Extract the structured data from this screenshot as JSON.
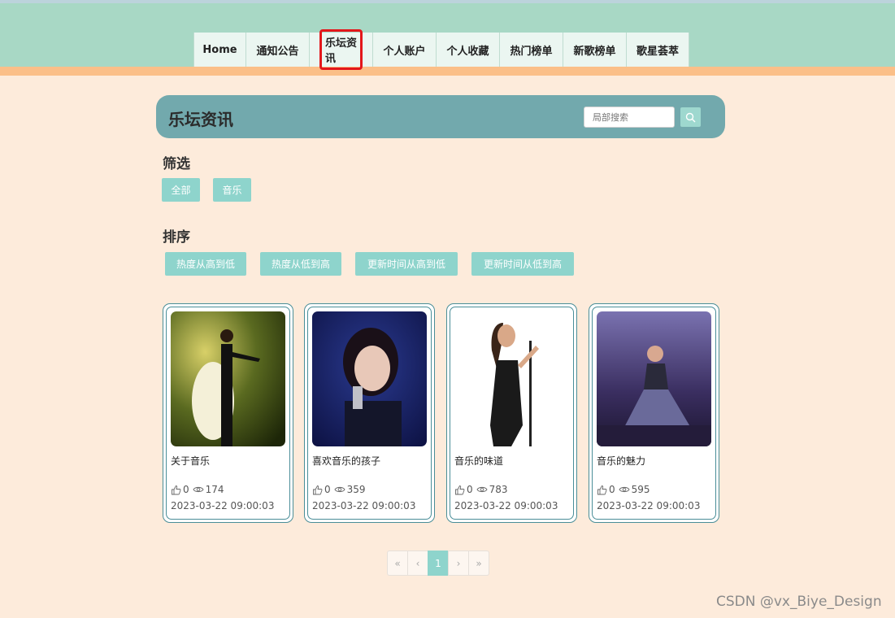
{
  "nav": {
    "items": [
      {
        "label": "Home"
      },
      {
        "label": "通知公告"
      },
      {
        "label": "乐坛资讯"
      },
      {
        "label": "个人账户"
      },
      {
        "label": "个人收藏"
      },
      {
        "label": "热门榜单"
      },
      {
        "label": "新歌榜单"
      },
      {
        "label": "歌星荟萃"
      }
    ],
    "active": "乐坛资讯"
  },
  "page": {
    "title": "乐坛资讯",
    "search_placeholder": "局部搜索"
  },
  "filter": {
    "label": "筛选",
    "options": [
      "全部",
      "音乐"
    ]
  },
  "sort": {
    "label": "排序",
    "options": [
      "热度从高到低",
      "热度从低到高",
      "更新时间从高到低",
      "更新时间从低到高"
    ]
  },
  "cards": [
    {
      "title": "关于音乐",
      "likes": "0",
      "views": "174",
      "date": "2023-03-22 09:00:03"
    },
    {
      "title": "喜欢音乐的孩子",
      "likes": "0",
      "views": "359",
      "date": "2023-03-22 09:00:03"
    },
    {
      "title": "音乐的味道",
      "likes": "0",
      "views": "783",
      "date": "2023-03-22 09:00:03"
    },
    {
      "title": "音乐的魅力",
      "likes": "0",
      "views": "595",
      "date": "2023-03-22 09:00:03"
    }
  ],
  "pagination": {
    "first": "«",
    "prev": "‹",
    "current": "1",
    "next": "›",
    "last": "»"
  },
  "watermark": "CSDN @vx_Biye_Design",
  "colors": {
    "header": "#a8d8c5",
    "accent_strip": "#fbbf88",
    "title_bar": "#72a9ad",
    "chip": "#8ed4cc",
    "background": "#fdebdb",
    "active_highlight": "#e3171b"
  }
}
